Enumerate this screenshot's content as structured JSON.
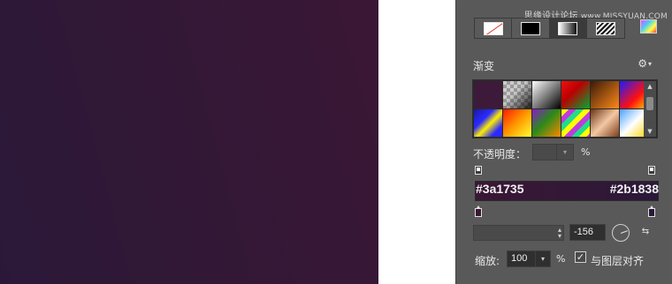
{
  "canvas": {
    "gradient_start": "#2b1838",
    "gradient_end": "#3a1735"
  },
  "watermark": {
    "title": "思缘设计论坛",
    "url": "www.MISSYUAN.COM"
  },
  "fill_types": [
    {
      "name": "no-fill",
      "icon": "slash-icon"
    },
    {
      "name": "solid-color",
      "icon": "black-swatch-icon"
    },
    {
      "name": "gradient",
      "icon": "gradient-swatch-icon"
    },
    {
      "name": "pattern",
      "icon": "hatch-pattern-icon"
    }
  ],
  "panel": {
    "section_label": "渐变",
    "gear_icon": "⚙",
    "gear_caret": "▾",
    "opacity_label": "不透明度：",
    "opacity_percent": "%",
    "grad_left_label": "#3a1735",
    "grad_right_label": "#2b1838",
    "angle_value": "-156",
    "scale_label": "缩放:",
    "scale_value": "100",
    "scale_percent": "%",
    "align_label": "与图层对齐",
    "align_checked": "✓",
    "scroll_up": "▲",
    "scroll_down": "▼",
    "dd_arrow": "▾",
    "style_arrows_up": "▴",
    "style_arrows_down": "▾",
    "reverse_icon": "⇆"
  }
}
